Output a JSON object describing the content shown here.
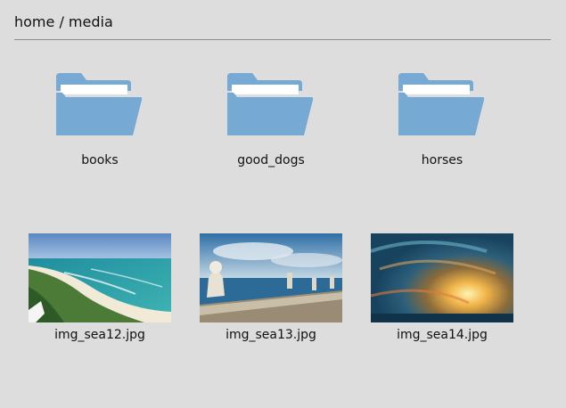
{
  "breadcrumb": "home / media",
  "colors": {
    "background": "#dddddd",
    "folder": "#76a9d3",
    "divider": "#8e8e8e"
  },
  "folders": [
    {
      "name": "books",
      "icon": "folder-icon"
    },
    {
      "name": "good_dogs",
      "icon": "folder-icon"
    },
    {
      "name": "horses",
      "icon": "folder-icon"
    }
  ],
  "files": [
    {
      "name": "img_sea12.jpg",
      "icon": "image-thumbnail"
    },
    {
      "name": "img_sea13.jpg",
      "icon": "image-thumbnail"
    },
    {
      "name": "img_sea14.jpg",
      "icon": "image-thumbnail"
    }
  ]
}
